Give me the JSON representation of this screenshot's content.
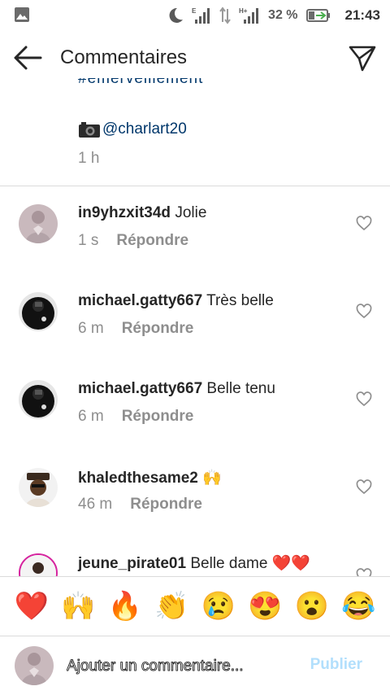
{
  "status_bar": {
    "battery_percent": "32 %",
    "time": "21:43",
    "icons": [
      "image-icon",
      "moon-icon",
      "signal-e-icon",
      "data-arrows-icon",
      "signal-h-plus-icon",
      "battery-charging-icon"
    ]
  },
  "header": {
    "title": "Commentaires",
    "back_icon": "arrow-left-icon",
    "send_icon": "paper-plane-icon"
  },
  "caption": {
    "clipped_text": "#émerveillement",
    "mention": "@charlart20",
    "time": "1 h"
  },
  "comments": [
    {
      "user": "in9yhzxit34d",
      "text": "Jolie",
      "time": "1 s",
      "reply": "Répondre"
    },
    {
      "user": "michael.gatty667",
      "text": "Très belle",
      "time": "6 m",
      "reply": "Répondre"
    },
    {
      "user": "michael.gatty667",
      "text": "Belle tenu",
      "time": "6 m",
      "reply": "Répondre"
    },
    {
      "user": "khaledthesame2",
      "text": "🙌",
      "time": "46 m",
      "reply": "Répondre"
    },
    {
      "user": "jeune_pirate01",
      "text": "Belle dame ❤️❤️",
      "time": "",
      "reply": ""
    }
  ],
  "emoji_bar": [
    "❤️",
    "🙌",
    "🔥",
    "👏",
    "😢",
    "😍",
    "😮",
    "😂"
  ],
  "composer": {
    "placeholder": "Ajouter un commentaire...",
    "publish_label": "Publier"
  },
  "colors": {
    "link": "#00376b",
    "secondary_text": "#8e8e8e",
    "publish_disabled": "#b2dffc",
    "story_ring": "#d6249f"
  }
}
